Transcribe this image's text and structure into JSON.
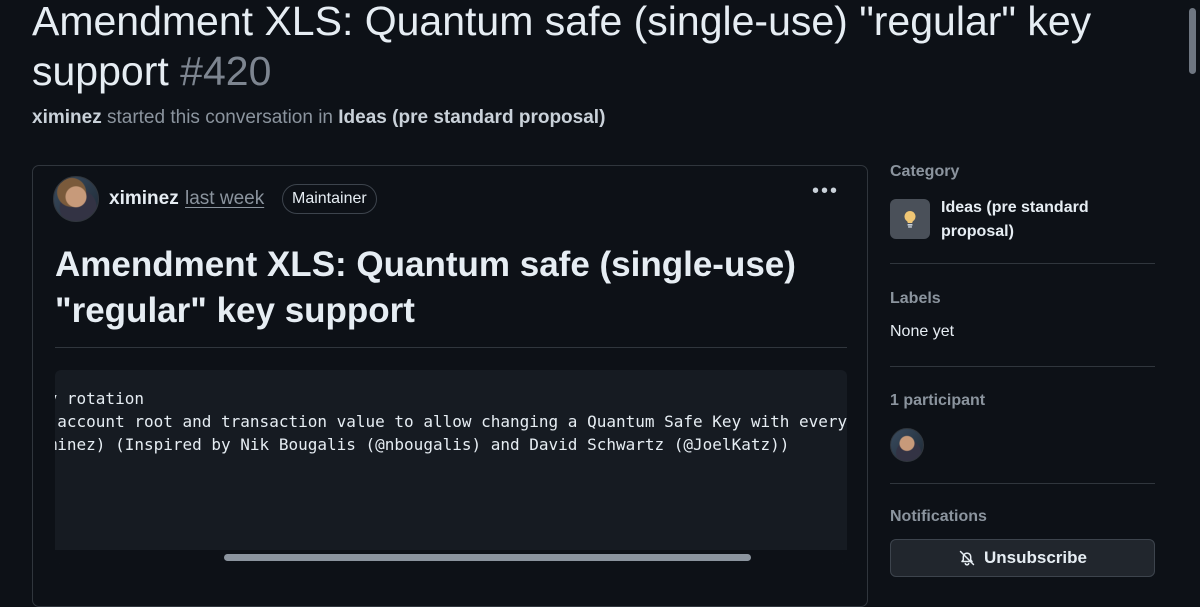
{
  "discussion": {
    "title": "Amendment XLS: Quantum safe (single-use) \"regular\" key support",
    "number": "#420",
    "starter": "ximinez",
    "started_text": "started this conversation in",
    "category_link": "Ideas (pre standard proposal)"
  },
  "post": {
    "author": "ximinez",
    "time": "last week",
    "badge": "Maintainer",
    "more_label": "•••",
    "heading": "Amendment XLS: Quantum safe (single-use) \"regular\" key support",
    "code_lines": [
      "ey rotation",
      "/ account root and transaction value to allow changing a Quantum Safe Key with every",
      "iminez) (Inspired by Nik Bougalis (@nbougalis) and David Schwartz (@JoelKatz))"
    ]
  },
  "sidebar": {
    "category_heading": "Category",
    "category_name": "Ideas (pre standard proposal)",
    "category_icon": "lightbulb-icon",
    "labels_heading": "Labels",
    "labels_value": "None yet",
    "participants_heading": "1 participant",
    "notifications_heading": "Notifications",
    "unsubscribe_label": "Unsubscribe",
    "unsubscribe_icon": "bell-slash-icon"
  }
}
